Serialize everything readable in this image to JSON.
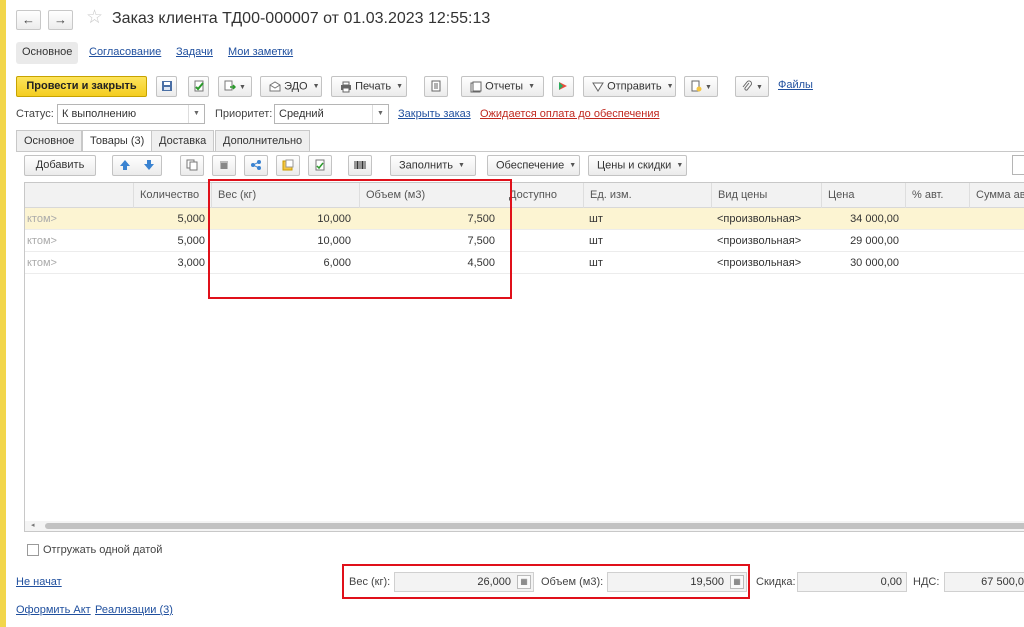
{
  "window": {
    "title": "Заказ клиента ТД00-000007 от 01.03.2023 12:55:13",
    "back_icon": "←",
    "forward_icon": "→",
    "star_icon": "☆"
  },
  "section_tabs": {
    "main": "Основное",
    "approval": "Согласование",
    "tasks": "Задачи",
    "notes": "Мои заметки"
  },
  "toolbar": {
    "post_close": "Провести и закрыть",
    "edo": "ЭДО",
    "print": "Печать",
    "reports": "Отчеты",
    "send": "Отправить",
    "files": "Файлы"
  },
  "status": {
    "label": "Статус:",
    "value": "К выполнению",
    "priority_label": "Приоритет:",
    "priority_value": "Средний",
    "close_order": "Закрыть заказ",
    "awaiting": "Ожидается оплата до обеспечения"
  },
  "inner_tabs": {
    "main": "Основное",
    "goods": "Товары (3)",
    "delivery": "Доставка",
    "additional": "Дополнительно"
  },
  "grid_toolbar": {
    "add": "Добавить",
    "fill": "Заполнить",
    "provision": "Обеспечение",
    "prices": "Цены и скидки"
  },
  "table": {
    "headers": {
      "qty": "Количество",
      "weight": "Вес (кг)",
      "volume": "Объем (м3)",
      "available": "Доступно",
      "unit": "Ед. изм.",
      "price_type": "Вид цены",
      "price": "Цена",
      "auto_pct": "% авт.",
      "amount": "Сумма ав"
    },
    "rows": [
      {
        "prefix": "ктом>",
        "qty": "5,000",
        "weight": "10,000",
        "volume": "7,500",
        "unit": "шт",
        "price_type": "<произвольная>",
        "price": "34 000,00"
      },
      {
        "prefix": "ктом>",
        "qty": "5,000",
        "weight": "10,000",
        "volume": "7,500",
        "unit": "шт",
        "price_type": "<произвольная>",
        "price": "29 000,00"
      },
      {
        "prefix": "ктом>",
        "qty": "3,000",
        "weight": "6,000",
        "volume": "4,500",
        "unit": "шт",
        "price_type": "<произвольная>",
        "price": "30 000,00"
      }
    ]
  },
  "ship_one_date": "Отгружать одной датой",
  "footer": {
    "not_started": "Не начат",
    "weight_label": "Вес (кг):",
    "weight_total": "26,000",
    "volume_label": "Объем (м3):",
    "volume_total": "19,500",
    "discount_label": "Скидка:",
    "discount_value": "0,00",
    "vat_label": "НДС:",
    "vat_value": "67 500,0",
    "make_act": "Оформить Акт",
    "sales": "Реализации (3)"
  }
}
